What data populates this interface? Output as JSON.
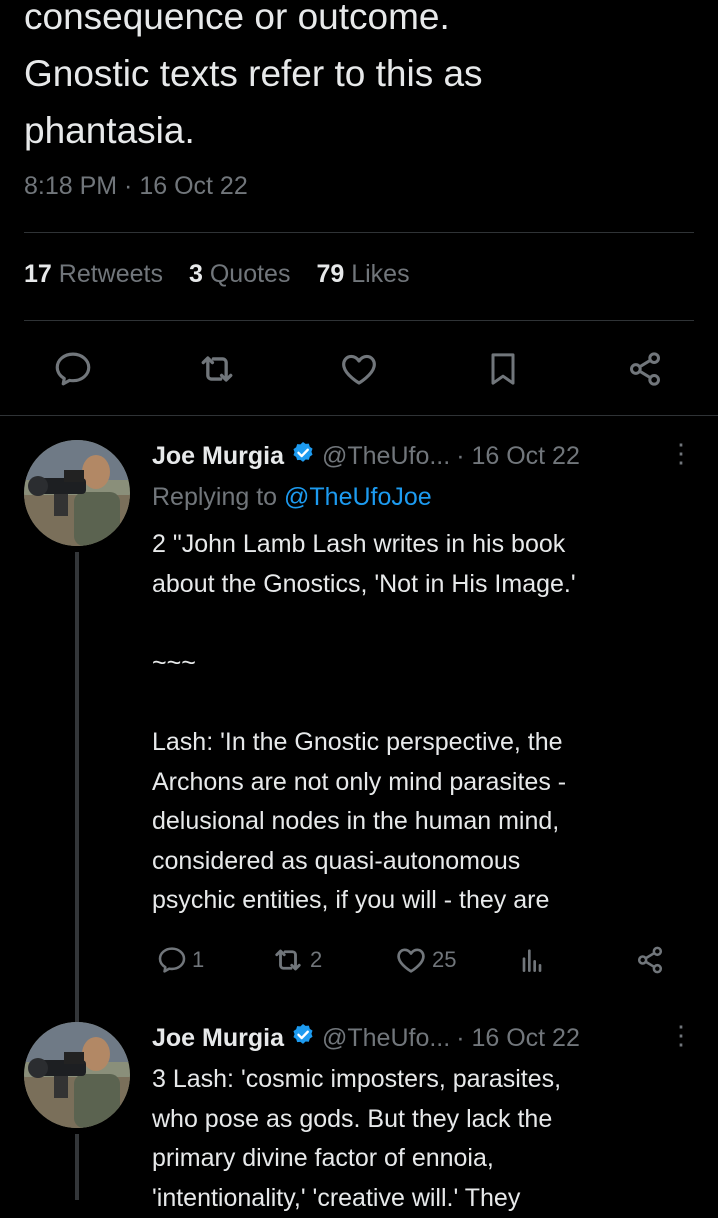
{
  "tweet": {
    "text_lines": [
      "consequence or outcome.",
      "Gnostic texts refer to this as",
      "phantasia."
    ],
    "timestamp": "8:18 PM · 16 Oct 22",
    "stats": {
      "retweets_count": "17",
      "retweets_label": "Retweets",
      "quotes_count": "3",
      "quotes_label": "Quotes",
      "likes_count": "79",
      "likes_label": "Likes"
    }
  },
  "replies": [
    {
      "name": "Joe Murgia",
      "handle": "@TheUfo...",
      "date": "· 16 Oct 22",
      "replying_prefix": "Replying to",
      "replying_to": "@TheUfoJoe",
      "lines": [
        "2 \"John Lamb Lash writes in his book",
        "about the Gnostics, 'Not in His Image.'",
        "",
        "~~~",
        "",
        "Lash: 'In the Gnostic perspective, the",
        "Archons are not only mind parasites -",
        "delusional nodes in the human mind,",
        "considered as quasi-autonomous",
        "psychic entities, if you will - they are"
      ],
      "reply_count": "1",
      "retweet_count": "2",
      "like_count": "25"
    },
    {
      "name": "Joe Murgia",
      "handle": "@TheUfo...",
      "date": "· 16 Oct 22",
      "lines": [
        "3 Lash: 'cosmic imposters, parasites,",
        "who pose as gods. But they lack the",
        "primary divine factor of ennoia,",
        "'intentionality,' 'creative will.' They"
      ]
    }
  ],
  "colors": {
    "accent": "#1d9bf0",
    "muted": "#71767b",
    "text": "#e7e9ea",
    "divider": "#2f3336"
  },
  "icons": [
    "reply-icon",
    "retweet-icon",
    "like-icon",
    "bookmark-icon",
    "share-icon",
    "analytics-icon",
    "verified-icon",
    "more-icon"
  ]
}
